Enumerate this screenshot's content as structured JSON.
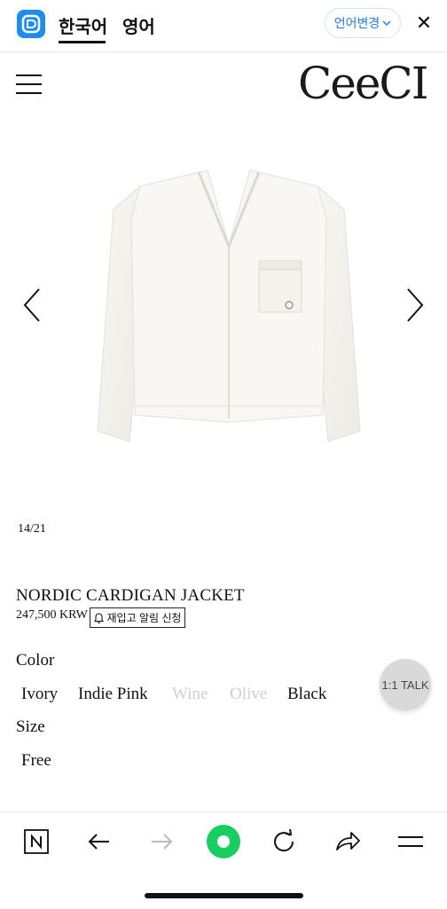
{
  "translate_bar": {
    "tab_korean": "한국어",
    "tab_english": "영어",
    "change_language_label": "언어변경",
    "close_symbol": "✕",
    "icons": {
      "app": "papago-icon",
      "close": "close-icon",
      "dropdown": "chevron-down-icon"
    },
    "accent_color": "#1e8cf0"
  },
  "header": {
    "logo_text": "CeeCI",
    "menu_icon": "hamburger-menu-icon"
  },
  "gallery": {
    "counter": "14/21",
    "prev_icon": "chevron-left-icon",
    "next_icon": "chevron-right-icon",
    "image_subject": "white v-neck cardigan jacket"
  },
  "product": {
    "name": "NORDIC CARDIGAN JACKET",
    "price": "247,500 KRW",
    "restock_label": "재입고 알림 신청",
    "restock_icon": "bell-icon",
    "color_label": "Color",
    "colors": [
      {
        "name": "Ivory",
        "available": true
      },
      {
        "name": "Indie Pink",
        "available": true
      },
      {
        "name": "Wine",
        "available": false
      },
      {
        "name": "Olive",
        "available": false
      },
      {
        "name": "Black",
        "available": true
      }
    ],
    "size_label": "Size",
    "sizes": [
      {
        "name": "Free",
        "available": true
      }
    ]
  },
  "chat": {
    "label": "1:1 TALK"
  },
  "browser_bar": {
    "icons": [
      "naver-n-icon",
      "back-arrow-icon",
      "forward-arrow-icon",
      "green-dot-home-icon",
      "refresh-icon",
      "share-icon",
      "menu-icon"
    ],
    "green_color": "#19ce60"
  }
}
